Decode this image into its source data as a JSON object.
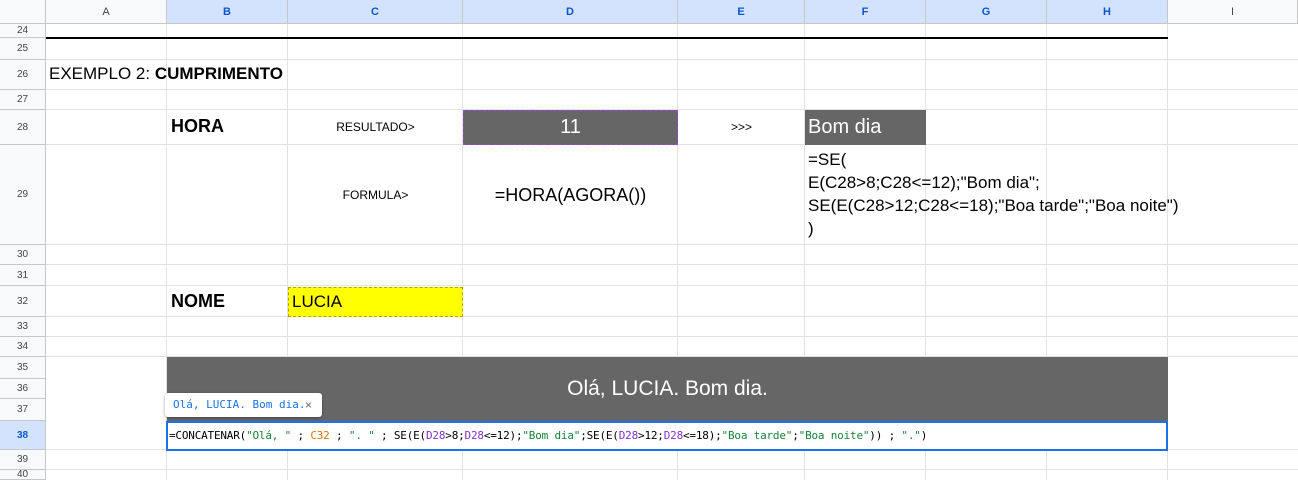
{
  "columns": [
    "A",
    "B",
    "C",
    "D",
    "E",
    "F",
    "G",
    "H",
    "I"
  ],
  "rows": [
    "24",
    "25",
    "26",
    "27",
    "28",
    "29",
    "30",
    "31",
    "32",
    "33",
    "34",
    "35",
    "36",
    "37",
    "38",
    "39",
    "40"
  ],
  "selected_row": "38",
  "title": {
    "prefix": "EXEMPLO 2: ",
    "bold": "CUMPRIMENTO"
  },
  "hora": {
    "label": "HORA",
    "resultado_label": "RESULTADO>",
    "value": "11",
    "arrow": ">>>",
    "greeting": "Bom dia"
  },
  "formula_row": {
    "label": "FORMULA>",
    "hora_formula": "=HORA(AGORA())",
    "se_formula_lines": [
      "=SE(",
      "E(C28>8;C28<=12);\"Bom dia\";",
      "SE(E(C28>12;C28<=18);\"Boa tarde\";\"Boa noite\")",
      ")"
    ]
  },
  "nome": {
    "label": "NOME",
    "value": "LUCIA"
  },
  "banner": {
    "text": "Olá, LUCIA. Bom dia."
  },
  "tooltip": {
    "text": "Olá, LUCIA. Bom dia.",
    "close": "×"
  },
  "editor": {
    "tokens": [
      {
        "t": "=CONCATENAR(",
        "c": "black"
      },
      {
        "t": "\"Olá, \"",
        "c": "green"
      },
      {
        "t": " ; ",
        "c": "black"
      },
      {
        "t": "C32",
        "c": "orange"
      },
      {
        "t": " ; ",
        "c": "black"
      },
      {
        "t": "\". \"",
        "c": "green"
      },
      {
        "t": " ; SE(E(",
        "c": "black"
      },
      {
        "t": "D28",
        "c": "purple"
      },
      {
        "t": ">8;",
        "c": "black"
      },
      {
        "t": "D28",
        "c": "purple"
      },
      {
        "t": "<=12);",
        "c": "black"
      },
      {
        "t": "\"Bom dia\"",
        "c": "green"
      },
      {
        "t": ";SE(E(",
        "c": "black"
      },
      {
        "t": "D28",
        "c": "purple"
      },
      {
        "t": ">12;",
        "c": "black"
      },
      {
        "t": "D28",
        "c": "purple"
      },
      {
        "t": "<=18);",
        "c": "black"
      },
      {
        "t": "\"Boa tarde\"",
        "c": "green"
      },
      {
        "t": ";",
        "c": "black"
      },
      {
        "t": "\"Boa noite\"",
        "c": "green"
      },
      {
        "t": ")) ; ",
        "c": "black"
      },
      {
        "t": "\".\"",
        "c": "green"
      },
      {
        "t": ")",
        "c": "black"
      }
    ]
  },
  "colors": {
    "selection": "#d3e3fd",
    "accent": "#0b57d0",
    "dark_fill": "#666666",
    "yellow_fill": "#ffff00"
  }
}
